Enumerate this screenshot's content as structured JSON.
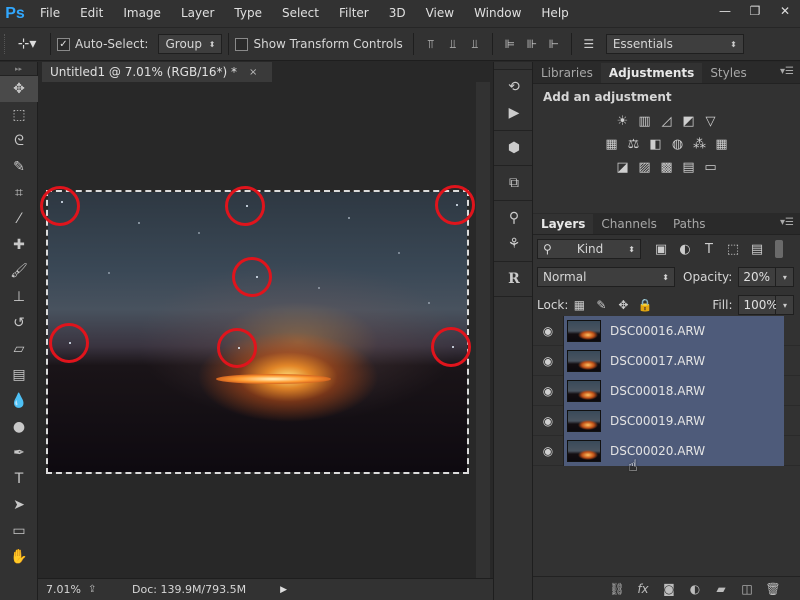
{
  "app": {
    "logo": "Ps"
  },
  "menu": [
    "File",
    "Edit",
    "Image",
    "Layer",
    "Type",
    "Select",
    "Filter",
    "3D",
    "View",
    "Window",
    "Help"
  ],
  "window_controls": {
    "minimize": "—",
    "restore": "❐",
    "close": "✕"
  },
  "options": {
    "tool_glyph": "⊹▾",
    "auto_select_label": "Auto-Select:",
    "auto_select_checked": true,
    "auto_select_mode": "Group",
    "transform_controls_label": "Show Transform Controls",
    "transform_controls_checked": false,
    "workspace": "Essentials"
  },
  "document": {
    "tab_title": "Untitled1 @ 7.01% (RGB/16*) *",
    "close": "×"
  },
  "status": {
    "zoom": "7.01%",
    "doc_size": "Doc: 139.9M/793.5M",
    "arrow": "▶"
  },
  "adjustments_panel": {
    "tabs": [
      "Libraries",
      "Adjustments",
      "Styles"
    ],
    "active_tab": "Adjustments",
    "title": "Add an adjustment",
    "row1": [
      "brightness-contrast-icon",
      "levels-icon",
      "curves-icon",
      "exposure-icon",
      "vibrance-icon"
    ],
    "row2": [
      "hue-saturation-icon",
      "color-balance-icon",
      "black-white-icon",
      "photo-filter-icon",
      "channel-mixer-icon",
      "color-lookup-icon"
    ],
    "row3": [
      "invert-icon",
      "posterize-icon",
      "threshold-icon",
      "gradient-map-icon",
      "selective-color-icon"
    ]
  },
  "layers_panel": {
    "tabs": [
      "Layers",
      "Channels",
      "Paths"
    ],
    "active_tab": "Layers",
    "filter_kind": "Kind",
    "blend_mode": "Normal",
    "opacity_label": "Opacity:",
    "opacity_value": "20%",
    "lock_label": "Lock:",
    "fill_label": "Fill:",
    "fill_value": "100%",
    "layers": [
      {
        "name": "DSC00016.ARW",
        "visible": true,
        "selected": true
      },
      {
        "name": "DSC00017.ARW",
        "visible": true,
        "selected": true
      },
      {
        "name": "DSC00018.ARW",
        "visible": true,
        "selected": true
      },
      {
        "name": "DSC00019.ARW",
        "visible": true,
        "selected": true
      },
      {
        "name": "DSC00020.ARW",
        "visible": true,
        "selected": true
      }
    ]
  },
  "colors": {
    "ui_dark": "#282828",
    "panel": "#323232",
    "layer_selected": "#4e5b7a",
    "ring": "#e0141c",
    "logo": "#31a8ff"
  }
}
